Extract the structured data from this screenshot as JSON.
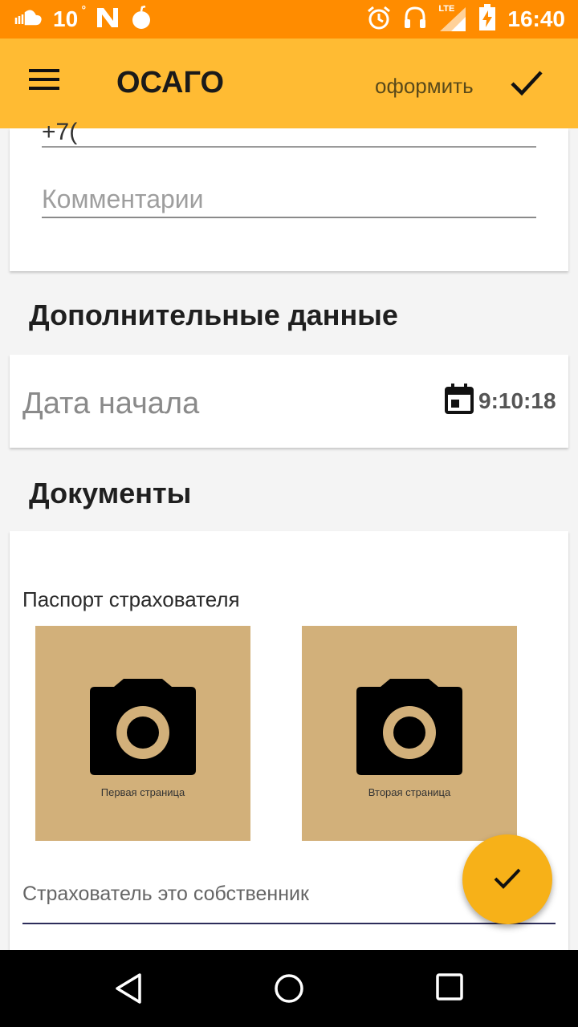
{
  "status_bar": {
    "temperature": "10",
    "degree": "°",
    "time": "16:40",
    "network": "LTE",
    "icons": [
      "soundcloud-icon",
      "n-notification-icon",
      "bomb-icon",
      "alarm-icon",
      "headphones-icon",
      "signal-icon",
      "battery-charging-icon"
    ]
  },
  "app_bar": {
    "title": "ОСАГО",
    "action_label": "оформить",
    "menu_icon": "hamburger-icon",
    "confirm_icon": "check-icon"
  },
  "form": {
    "partial_value": "+7(",
    "comment_placeholder": "Комментарии",
    "comment_value": ""
  },
  "additional": {
    "title": "Дополнительные данные",
    "start_date_label": "Дата начала",
    "start_date_value": "9:10:18",
    "calendar_icon": "calendar-icon"
  },
  "documents": {
    "title": "Документы",
    "passport_label": "Паспорт страхователя",
    "tiles": [
      {
        "caption": "Первая страница",
        "icon": "camera-icon"
      },
      {
        "caption": "Вторая страница",
        "icon": "camera-icon"
      }
    ],
    "owner_field_label": "Страхователь это собственник"
  },
  "fab": {
    "icon": "check-icon"
  },
  "colors": {
    "status_bar": "#ff8c00",
    "app_bar": "#ffbb33",
    "tile": "#d2b07a",
    "fab": "#f7b118"
  },
  "nav_bar": {
    "icons": [
      "back-icon",
      "home-icon",
      "recents-icon"
    ]
  }
}
